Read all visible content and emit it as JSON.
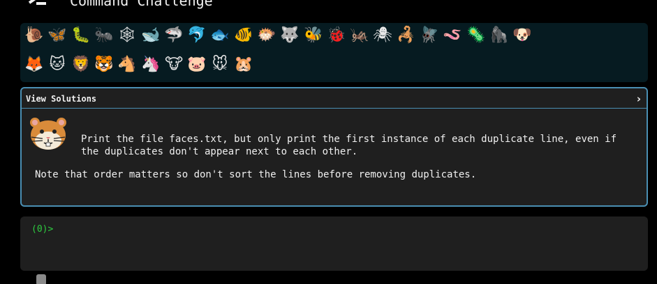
{
  "header": {
    "title": "Command Challenge",
    "logo_icon": "command-line-logo-icon"
  },
  "levels": [
    {
      "name": "snail-icon",
      "glyph": "🐌"
    },
    {
      "name": "butterfly-icon",
      "glyph": "🦋"
    },
    {
      "name": "caterpillar-icon",
      "glyph": "🐛"
    },
    {
      "name": "ant-icon",
      "glyph": "🐜"
    },
    {
      "name": "spider-web-icon",
      "glyph": "🕸"
    },
    {
      "name": "whale-icon",
      "glyph": "🐋"
    },
    {
      "name": "shark-icon",
      "glyph": "🦈"
    },
    {
      "name": "dolphin-icon",
      "glyph": "🐬"
    },
    {
      "name": "fish-icon",
      "glyph": "🐟"
    },
    {
      "name": "tropical-fish-icon",
      "glyph": "🐠"
    },
    {
      "name": "blowfish-icon",
      "glyph": "🐡"
    },
    {
      "name": "wolf-icon",
      "glyph": "🐺"
    },
    {
      "name": "bee-icon",
      "glyph": "🐝"
    },
    {
      "name": "ladybug-icon",
      "glyph": "🐞"
    },
    {
      "name": "cricket-icon",
      "glyph": "🦗"
    },
    {
      "name": "spider-icon",
      "glyph": "🕷"
    },
    {
      "name": "scorpion-icon",
      "glyph": "🦂"
    },
    {
      "name": "fly-icon",
      "glyph": "🪰"
    },
    {
      "name": "worm-icon",
      "glyph": "🪱"
    },
    {
      "name": "microbe-icon",
      "glyph": "🦠"
    },
    {
      "name": "gorilla-icon",
      "glyph": "🦍"
    },
    {
      "name": "dog-face-icon",
      "glyph": "🐶"
    },
    {
      "name": "fox-icon",
      "glyph": "🦊"
    },
    {
      "name": "cat-face-icon",
      "glyph": "🐱"
    },
    {
      "name": "lion-icon",
      "glyph": "🦁"
    },
    {
      "name": "tiger-face-icon",
      "glyph": "🐯"
    },
    {
      "name": "horse-face-icon",
      "glyph": "🐴"
    },
    {
      "name": "unicorn-icon",
      "glyph": "🦄"
    },
    {
      "name": "cow-face-icon",
      "glyph": "🐮"
    },
    {
      "name": "pig-face-icon",
      "glyph": "🐷"
    },
    {
      "name": "mouse-face-icon",
      "glyph": "🐭"
    },
    {
      "name": "hamster-icon",
      "glyph": "🐹",
      "current": true
    }
  ],
  "solutions": {
    "label": "View Solutions",
    "chevron": "›"
  },
  "challenge": {
    "icon": "hamster-icon",
    "description": "Print the file faces.txt, but only print the first instance of each duplicate line, even if the duplicates don't appear next to each other.",
    "note": "Note that order matters so don't sort the lines before removing duplicates."
  },
  "terminal": {
    "prompt": "(0)>"
  }
}
